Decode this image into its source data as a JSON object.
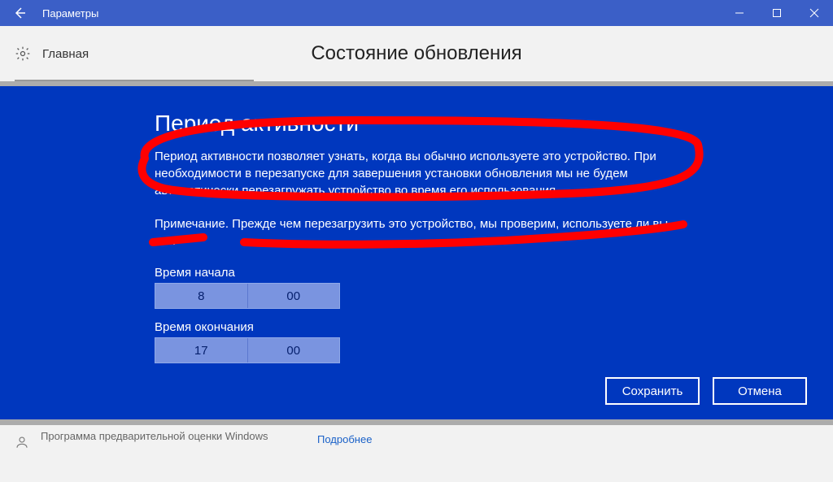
{
  "titlebar": {
    "title": "Параметры"
  },
  "subheader": {
    "home": "Главная",
    "page_title": "Состояние обновления"
  },
  "modal": {
    "heading": "Период активности",
    "paragraph1": "Период активности позволяет узнать, когда вы обычно используете это устройство. При необходимости в перезапуске для завершения установки обновления мы не будем автоматически перезагружать устройство во время его использования.",
    "paragraph2": "Примечание. Прежде чем перезагрузить это устройство, мы проверим, используете ли вы его.",
    "start_label": "Время начала",
    "start_hour": "8",
    "start_minute": "00",
    "end_label": "Время окончания",
    "end_hour": "17",
    "end_minute": "00",
    "save": "Сохранить",
    "cancel": "Отмена"
  },
  "bottom": {
    "left_text": "Программа предварительной оценки Windows",
    "right_link": "Подробнее"
  }
}
